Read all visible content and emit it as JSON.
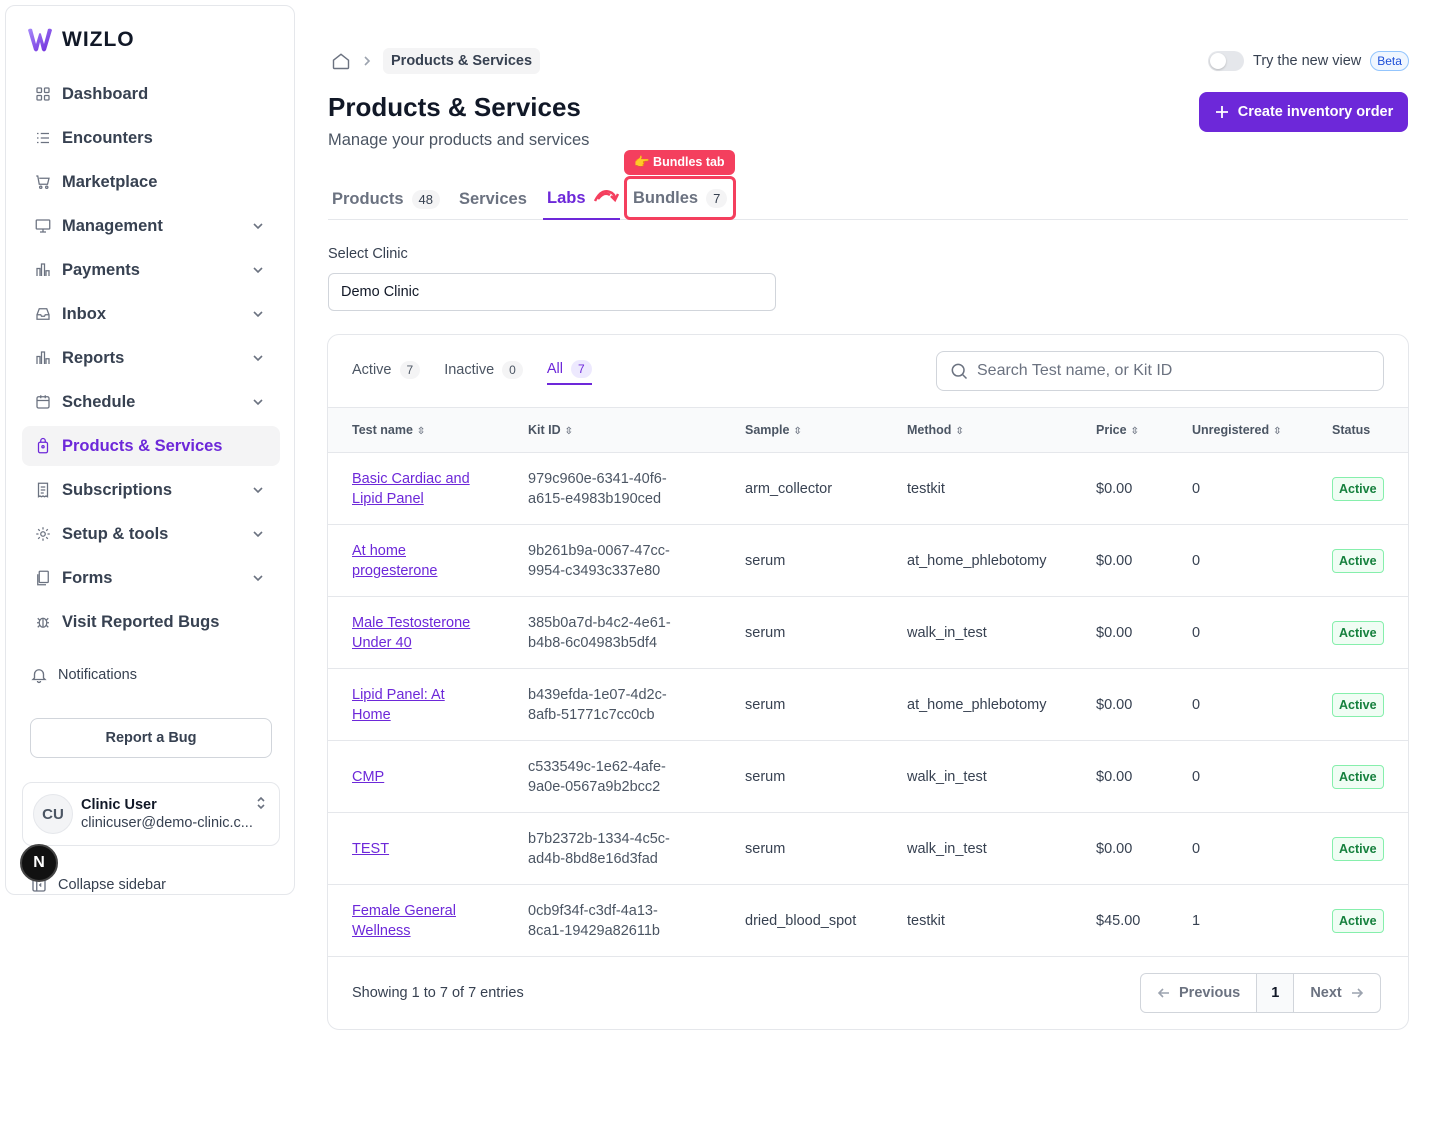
{
  "sidebar": {
    "brand": "WIZLO",
    "items": [
      {
        "label": "Dashboard",
        "icon": "grid-icon",
        "chevron": false
      },
      {
        "label": "Encounters",
        "icon": "list-icon",
        "chevron": false
      },
      {
        "label": "Marketplace",
        "icon": "cart-icon",
        "chevron": false
      },
      {
        "label": "Management",
        "icon": "monitor-icon",
        "chevron": true
      },
      {
        "label": "Payments",
        "icon": "bar-chart-icon",
        "chevron": true
      },
      {
        "label": "Inbox",
        "icon": "inbox-icon",
        "chevron": true
      },
      {
        "label": "Reports",
        "icon": "report-icon",
        "chevron": true
      },
      {
        "label": "Schedule",
        "icon": "calendar-icon",
        "chevron": true
      },
      {
        "label": "Products & Services",
        "icon": "bag-icon",
        "chevron": false,
        "active": true
      },
      {
        "label": "Subscriptions",
        "icon": "receipt-icon",
        "chevron": true
      },
      {
        "label": "Setup & tools",
        "icon": "gear-icon",
        "chevron": true
      },
      {
        "label": "Forms",
        "icon": "forms-icon",
        "chevron": true
      },
      {
        "label": "Visit Reported Bugs",
        "icon": "bug-icon",
        "chevron": false
      }
    ],
    "notifications": "Notifications",
    "report_bug": "Report a Bug",
    "user": {
      "initials": "CU",
      "name": "Clinic User",
      "email": "clinicuser@demo-clinic.c..."
    },
    "collapse": "Collapse sidebar",
    "n_badge": "N"
  },
  "header": {
    "breadcrumb_current": "Products & Services",
    "try_view": "Try the new view",
    "beta": "Beta",
    "title": "Products & Services",
    "subtitle": "Manage your products and services",
    "create_button": "Create inventory order"
  },
  "tabs": {
    "products": {
      "label": "Products",
      "count": "48"
    },
    "services": {
      "label": "Services"
    },
    "labs": {
      "label": "Labs"
    },
    "bundles": {
      "label": "Bundles",
      "count": "7"
    },
    "tooltip": "👉 Bundles tab"
  },
  "clinic": {
    "label": "Select Clinic",
    "value": "Demo Clinic"
  },
  "filters": {
    "active": {
      "label": "Active",
      "count": "7"
    },
    "inactive": {
      "label": "Inactive",
      "count": "0"
    },
    "all": {
      "label": "All",
      "count": "7"
    }
  },
  "search": {
    "placeholder": "Search Test name, or Kit ID"
  },
  "table": {
    "headers": [
      "Test name",
      "Kit ID",
      "Sample",
      "Method",
      "Price",
      "Unregistered",
      "Status"
    ],
    "rows": [
      {
        "name": [
          "Basic Cardiac and",
          "Lipid Panel"
        ],
        "kit": [
          "979c960e-6341-40f6-",
          "a615-e4983b190ced"
        ],
        "sample": "arm_collector",
        "method": "testkit",
        "price": "$0.00",
        "unregistered": "0",
        "status": "Active"
      },
      {
        "name": [
          "At home",
          "progesterone"
        ],
        "kit": [
          "9b261b9a-0067-47cc-",
          "9954-c3493c337e80"
        ],
        "sample": "serum",
        "method": "at_home_phlebotomy",
        "price": "$0.00",
        "unregistered": "0",
        "status": "Active"
      },
      {
        "name": [
          "Male Testosterone",
          "Under 40"
        ],
        "kit": [
          "385b0a7d-b4c2-4e61-",
          "b4b8-6c04983b5df4"
        ],
        "sample": "serum",
        "method": "walk_in_test",
        "price": "$0.00",
        "unregistered": "0",
        "status": "Active"
      },
      {
        "name": [
          "Lipid Panel: At",
          "Home"
        ],
        "kit": [
          "b439efda-1e07-4d2c-",
          "8afb-51771c7cc0cb"
        ],
        "sample": "serum",
        "method": "at_home_phlebotomy",
        "price": "$0.00",
        "unregistered": "0",
        "status": "Active"
      },
      {
        "name": [
          "CMP",
          ""
        ],
        "kit": [
          "c533549c-1e62-4afe-",
          "9a0e-0567a9b2bcc2"
        ],
        "sample": "serum",
        "method": "walk_in_test",
        "price": "$0.00",
        "unregistered": "0",
        "status": "Active"
      },
      {
        "name": [
          "TEST",
          ""
        ],
        "kit": [
          "b7b2372b-1334-4c5c-",
          "ad4b-8bd8e16d3fad"
        ],
        "sample": "serum",
        "method": "walk_in_test",
        "price": "$0.00",
        "unregistered": "0",
        "status": "Active"
      },
      {
        "name": [
          "Female General",
          "Wellness"
        ],
        "kit": [
          "0cb9f34f-c3df-4a13-",
          "8ca1-19429a82611b"
        ],
        "sample": "dried_blood_spot",
        "method": "testkit",
        "price": "$45.00",
        "unregistered": "1",
        "status": "Active"
      }
    ]
  },
  "footer": {
    "showing": "Showing 1 to 7 of 7 entries",
    "previous": "Previous",
    "page": "1",
    "next": "Next"
  },
  "colors": {
    "accent": "#6d28d9",
    "highlight": "#f43f5e",
    "active_status": "#15803d"
  }
}
